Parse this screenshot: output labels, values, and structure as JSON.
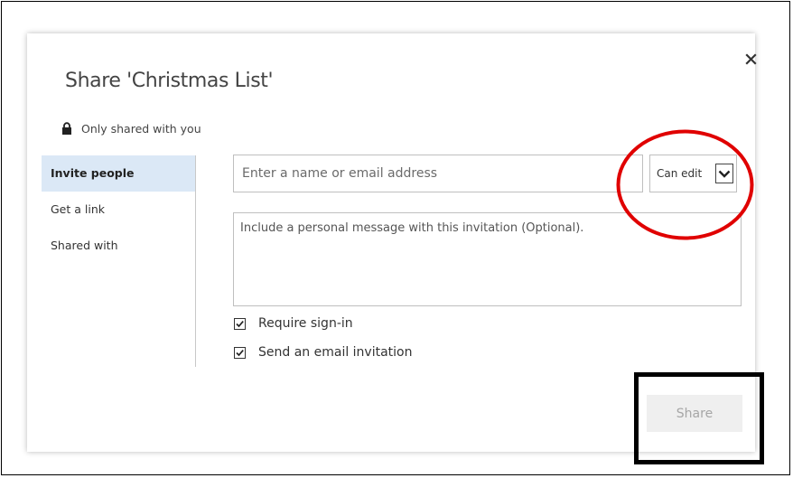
{
  "dialog": {
    "title": "Share 'Christmas List'",
    "privacy_text": "Only shared with you",
    "close_icon": "close-icon"
  },
  "nav": {
    "items": [
      {
        "label": "Invite people",
        "active": true
      },
      {
        "label": "Get a link",
        "active": false
      },
      {
        "label": "Shared with",
        "active": false
      }
    ]
  },
  "invite": {
    "email_placeholder": "Enter a name or email address",
    "permission": "Can edit",
    "message_placeholder": "Include a personal message with this invitation (Optional).",
    "require_signin_label": "Require sign-in",
    "require_signin_checked": true,
    "send_email_label": "Send an email invitation",
    "send_email_checked": true
  },
  "actions": {
    "share_label": "Share"
  },
  "colors": {
    "nav_active_bg": "#dbe8f6",
    "share_button_bg": "#efefef",
    "share_button_text": "#a6a6a6",
    "annotation_circle": "#e00000",
    "annotation_box": "#000000"
  }
}
